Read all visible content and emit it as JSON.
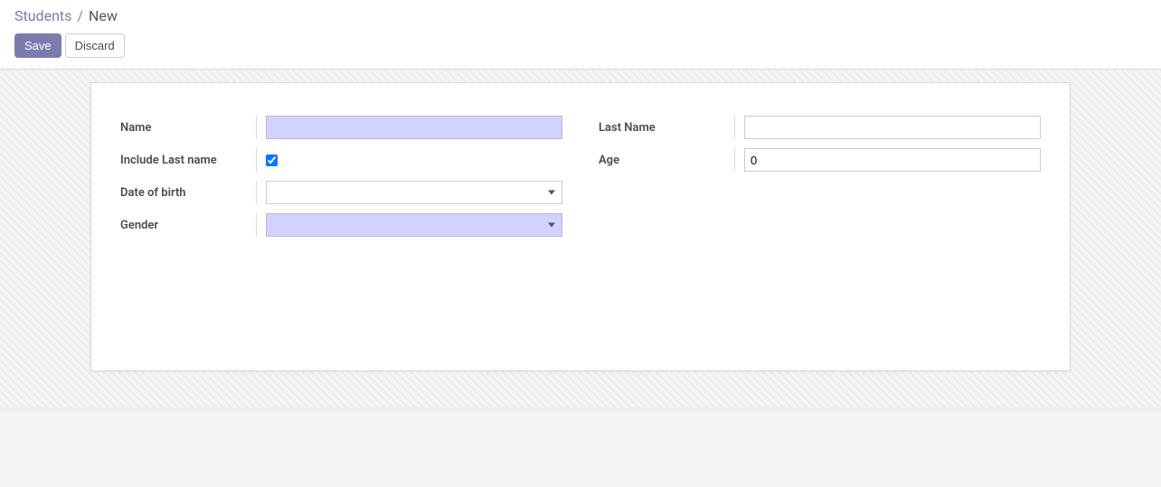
{
  "breadcrumb": {
    "link": "Students",
    "separator": "/",
    "current": "New"
  },
  "toolbar": {
    "save_label": "Save",
    "discard_label": "Discard"
  },
  "form": {
    "left": {
      "name_label": "Name",
      "name_value": "",
      "include_lastname_label": "Include Last name",
      "include_lastname_checked": true,
      "dob_label": "Date of birth",
      "dob_value": "",
      "gender_label": "Gender",
      "gender_value": ""
    },
    "right": {
      "lastname_label": "Last Name",
      "lastname_value": "",
      "age_label": "Age",
      "age_value": "0"
    }
  }
}
